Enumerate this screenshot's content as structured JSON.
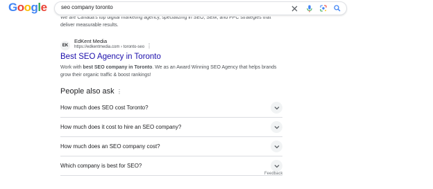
{
  "header": {
    "logo_letters": [
      {
        "ch": "G",
        "color": "#4285F4"
      },
      {
        "ch": "o",
        "color": "#EA4335"
      },
      {
        "ch": "o",
        "color": "#FBBC05"
      },
      {
        "ch": "g",
        "color": "#4285F4"
      },
      {
        "ch": "l",
        "color": "#34A853"
      },
      {
        "ch": "e",
        "color": "#EA4335"
      }
    ],
    "query": "seo company toronto",
    "icons": [
      "close-icon",
      "microphone-icon",
      "lens-icon",
      "search-icon"
    ]
  },
  "top_snippet": {
    "line1": "We are Canada's top digital marketing agency, specializing in SEO, SEM, and PPC strategies that",
    "line2": "deliver measurable results."
  },
  "result": {
    "favicon_text": "EK",
    "site_name": "EdKent Media",
    "url": "https://edkentmedia.com › toronto-seo",
    "title": "Best SEO Agency in Toronto",
    "desc_pre": "Work with ",
    "desc_bold": "best SEO company in Toronto",
    "desc_post": ". We as an Award Winning SEO Agency that helps brands grow their organic traffic & boost rankings!"
  },
  "paa": {
    "heading": "People also ask",
    "questions": [
      "How much does SEO cost Toronto?",
      "How much does it cost to hire an SEO company?",
      "How much does an SEO company cost?",
      "Which company is best for SEO?"
    ],
    "feedback": "Feedback"
  }
}
